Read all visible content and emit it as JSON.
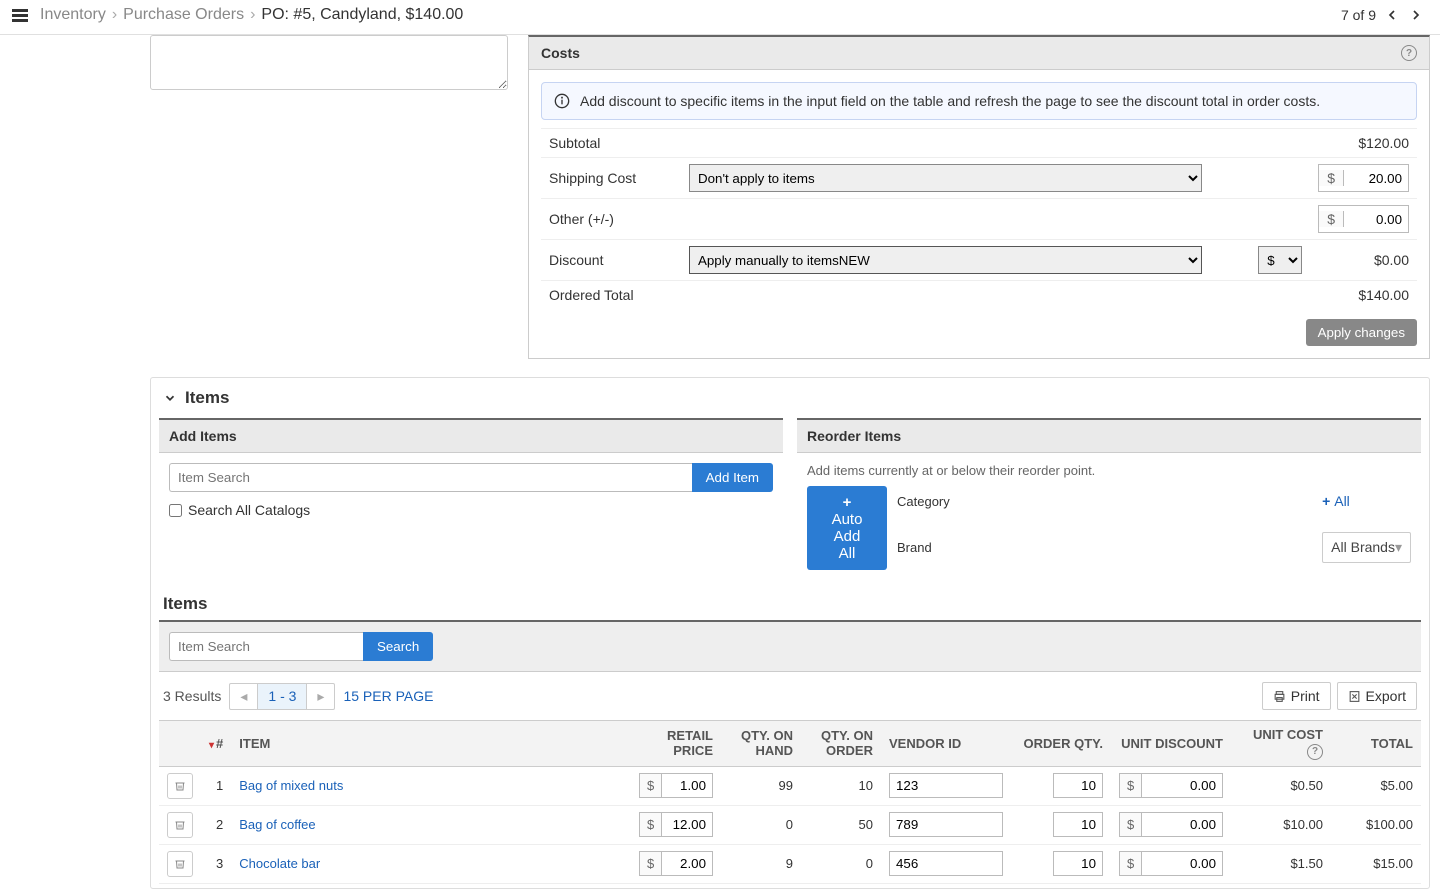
{
  "breadcrumb": {
    "inventory": "Inventory",
    "purchase_orders": "Purchase Orders",
    "current": "PO: #5, Candyland, $140.00"
  },
  "pager": {
    "text": "7 of 9"
  },
  "costs": {
    "title": "Costs",
    "info": "Add discount to specific items in the input field on the table and refresh the page to see the discount total in order costs.",
    "subtotal_label": "Subtotal",
    "subtotal": "$120.00",
    "shipping_label": "Shipping Cost",
    "shipping_select": "Don't apply to items",
    "shipping_value": "20.00",
    "other_label": "Other (+/-)",
    "other_value": "0.00",
    "discount_label": "Discount",
    "discount_select": "Apply manually to items",
    "discount_unit": "$",
    "discount_value": "$0.00",
    "ordered_total_label": "Ordered Total",
    "ordered_total": "$140.00",
    "apply_button": "Apply changes",
    "currency": "$",
    "new_badge": "NEW"
  },
  "items_section": {
    "title": "Items",
    "add_items": {
      "title": "Add Items",
      "search_placeholder": "Item Search",
      "add_button": "Add Item",
      "checkbox": "Search All Catalogs"
    },
    "reorder": {
      "title": "Reorder Items",
      "hint": "Add items currently at or below their reorder point.",
      "category_label": "Category",
      "all_link": "All",
      "brand_label": "Brand",
      "brand_value": "All Brands",
      "auto_add": "Auto Add All"
    },
    "list": {
      "title": "Items",
      "search_placeholder": "Item Search",
      "search_button": "Search",
      "results": "3 Results",
      "page_range": "1 - 3",
      "per_page": "15 PER PAGE",
      "print": "Print",
      "export": "Export",
      "headers": {
        "num": "#",
        "item": "ITEM",
        "retail": "RETAIL PRICE",
        "on_hand": "QTY. ON HAND",
        "on_order": "QTY. ON ORDER",
        "vendor": "VENDOR ID",
        "order_qty": "ORDER QTY.",
        "unit_disc": "UNIT DISCOUNT",
        "unit_cost": "UNIT COST",
        "total": "TOTAL"
      },
      "rows": [
        {
          "num": "1",
          "item": "Bag of mixed nuts",
          "retail": "1.00",
          "on_hand": "99",
          "on_order": "10",
          "vendor": "123",
          "qty": "10",
          "disc": "0.00",
          "unit_cost": "$0.50",
          "total": "$5.00"
        },
        {
          "num": "2",
          "item": "Bag of coffee",
          "retail": "12.00",
          "on_hand": "0",
          "on_order": "50",
          "vendor": "789",
          "qty": "10",
          "disc": "0.00",
          "unit_cost": "$10.00",
          "total": "$100.00"
        },
        {
          "num": "3",
          "item": "Chocolate bar",
          "retail": "2.00",
          "on_hand": "9",
          "on_order": "0",
          "vendor": "456",
          "qty": "10",
          "disc": "0.00",
          "unit_cost": "$1.50",
          "total": "$15.00"
        }
      ]
    }
  }
}
